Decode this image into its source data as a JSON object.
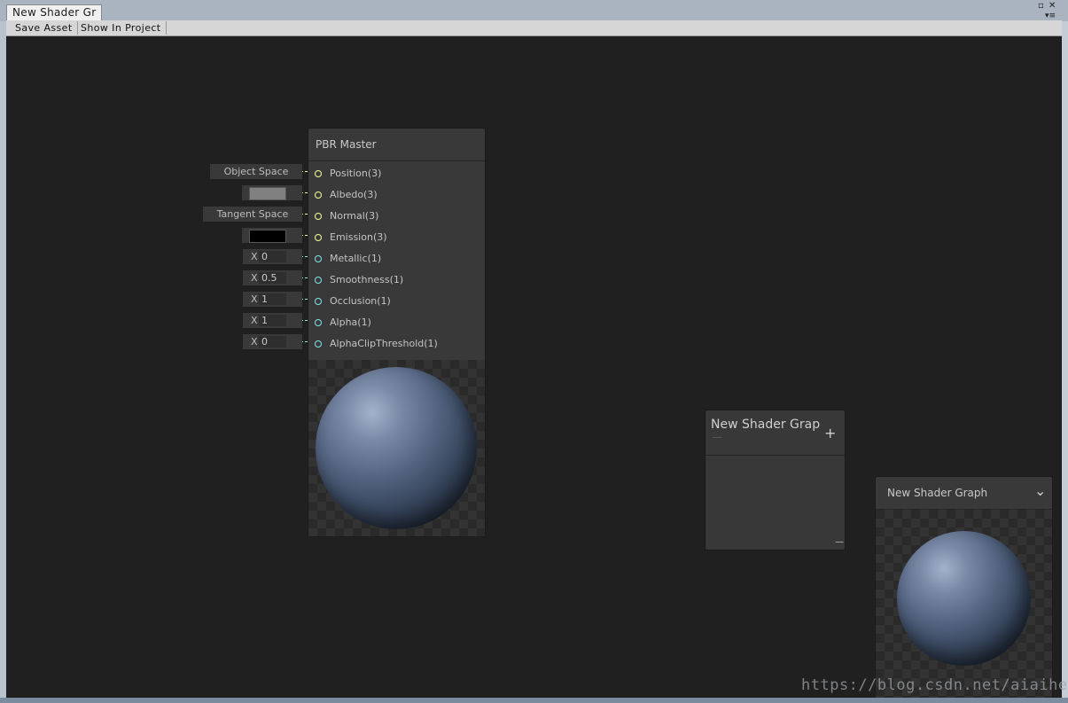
{
  "window": {
    "tab_title": "New Shader Gr",
    "restore_glyph": "▫",
    "close_glyph": "✕",
    "menu_glyph": "▾≡"
  },
  "toolbar": {
    "save_asset": "Save Asset",
    "show_in_project": "Show In Project"
  },
  "pbr_master": {
    "title": "PBR Master",
    "ports": [
      {
        "label": "Position(3)",
        "type": "vector3",
        "field": {
          "kind": "text",
          "value": "Object Space"
        }
      },
      {
        "label": "Albedo(3)",
        "type": "vector3",
        "field": {
          "kind": "color",
          "value": "#808080"
        }
      },
      {
        "label": "Normal(3)",
        "type": "vector3",
        "field": {
          "kind": "text",
          "value": "Tangent Space"
        }
      },
      {
        "label": "Emission(3)",
        "type": "vector3",
        "field": {
          "kind": "color",
          "value": "#000000"
        }
      },
      {
        "label": "Metallic(1)",
        "type": "float",
        "field": {
          "kind": "float",
          "prefix": "X",
          "value": "0"
        }
      },
      {
        "label": "Smoothness(1)",
        "type": "float",
        "field": {
          "kind": "float",
          "prefix": "X",
          "value": "0.5"
        }
      },
      {
        "label": "Occlusion(1)",
        "type": "float",
        "field": {
          "kind": "float",
          "prefix": "X",
          "value": "1"
        }
      },
      {
        "label": "Alpha(1)",
        "type": "float",
        "field": {
          "kind": "float",
          "prefix": "X",
          "value": "1"
        }
      },
      {
        "label": "AlphaClipThreshold(1)",
        "type": "float",
        "field": {
          "kind": "float",
          "prefix": "X",
          "value": "0"
        }
      }
    ]
  },
  "blackboard": {
    "title": "New Shader Graph",
    "add_glyph": "+",
    "resize_glyph": "—"
  },
  "main_preview": {
    "title": "New Shader Graph",
    "collapse_glyph": "⌄"
  },
  "watermark": "https://blog.csdn.net/aiaihe",
  "colors": {
    "vector3_port": "#f6ff9a",
    "float_port": "#84e4e7",
    "canvas_bg": "#202020",
    "node_bg": "#393939"
  }
}
